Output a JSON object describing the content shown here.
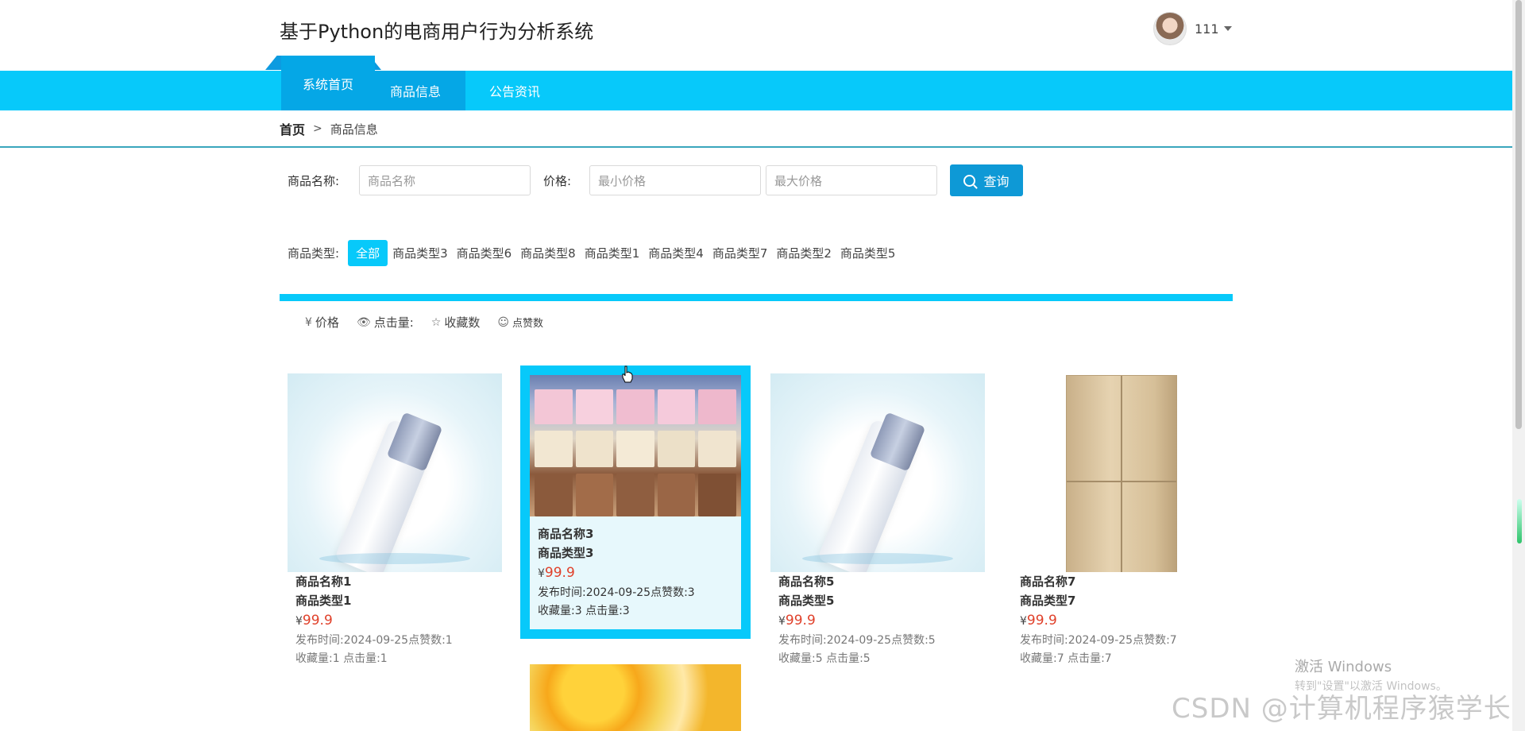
{
  "header": {
    "site_title": "基于Python的电商用户行为分析系统",
    "user_name": "111"
  },
  "nav": {
    "tabs": [
      "系统首页",
      "商品信息",
      "公告资讯"
    ]
  },
  "breadcrumb": {
    "home": "首页",
    "separator": ">",
    "current": "商品信息"
  },
  "search": {
    "name_label": "商品名称:",
    "name_placeholder": "商品名称",
    "price_label": "价格:",
    "min_placeholder": "最小价格",
    "max_placeholder": "最大价格",
    "button_label": "查询"
  },
  "types": {
    "label": "商品类型:",
    "items": [
      "全部",
      "商品类型3",
      "商品类型6",
      "商品类型8",
      "商品类型1",
      "商品类型4",
      "商品类型7",
      "商品类型2",
      "商品类型5"
    ]
  },
  "sort": {
    "price": "价格",
    "clicks": "点击量:",
    "favorites": "收藏数",
    "likes": "点赞数"
  },
  "products": [
    {
      "name": "商品名称1",
      "type": "商品类型1",
      "yen": "¥",
      "price": "99.9",
      "meta1": "发布时间:2024-09-25点赞数:1",
      "meta2": "收藏量:1 点击量:1"
    },
    {
      "name": "商品名称3",
      "type": "商品类型3",
      "yen": "¥",
      "price": "99.9",
      "meta1": "发布时间:2024-09-25点赞数:3",
      "meta2": "收藏量:3 点击量:3"
    },
    {
      "name": "商品名称5",
      "type": "商品类型5",
      "yen": "¥",
      "price": "99.9",
      "meta1": "发布时间:2024-09-25点赞数:5",
      "meta2": "收藏量:5 点击量:5"
    },
    {
      "name": "商品名称7",
      "type": "商品类型7",
      "yen": "¥",
      "price": "99.9",
      "meta1": "发布时间:2024-09-25点赞数:7",
      "meta2": "收藏量:7 点击量:7"
    }
  ],
  "watermarks": {
    "windows_line1": "激活 Windows",
    "windows_line2": "转到\"设置\"以激活 Windows。",
    "csdn": "CSDN @计算机程序猿学长"
  },
  "colors": {
    "nav": "#07c9fa",
    "nav_active": "#05a7e6",
    "button": "#0e99d6",
    "price": "#e0402a"
  }
}
